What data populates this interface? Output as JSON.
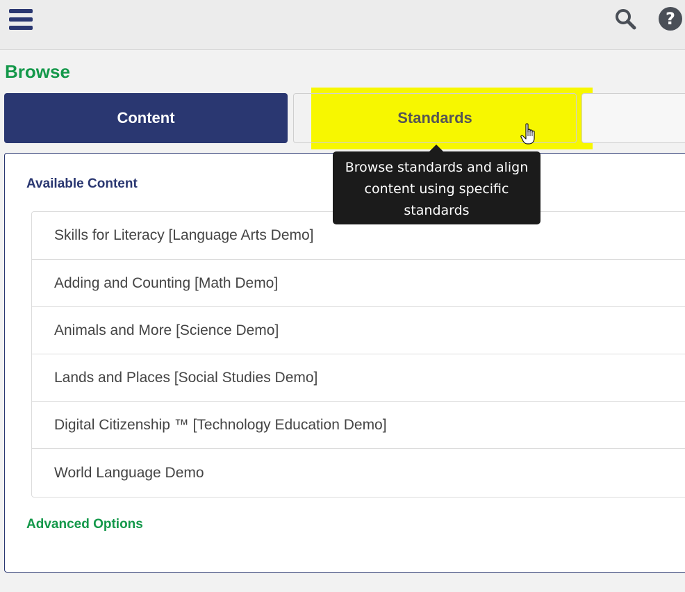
{
  "header": {
    "menu_icon": "hamburger-menu-icon",
    "search_icon": "search-icon",
    "help_icon": "help-circle-icon"
  },
  "page": {
    "title": "Browse"
  },
  "tabs": [
    {
      "label": "Content",
      "active": true
    },
    {
      "label": "Standards",
      "active": false,
      "highlighted": true
    },
    {
      "label": ""
    }
  ],
  "tooltip": {
    "text": "Browse standards and align content using specific standards"
  },
  "available_content": {
    "heading": "Available Content",
    "items": [
      "Skills for Literacy [Language Arts Demo]",
      "Adding and Counting [Math Demo]",
      "Animals and More [Science Demo]",
      "Lands and Places [Social Studies Demo]",
      "Digital Citizenship ™ [Technology Education Demo]",
      "World Language Demo"
    ]
  },
  "advanced_options": {
    "label": "Advanced Options"
  },
  "colors": {
    "navy": "#2a3771",
    "green": "#14984a",
    "highlight_yellow": "#f7f700",
    "tooltip_bg": "#1b1b1b"
  }
}
